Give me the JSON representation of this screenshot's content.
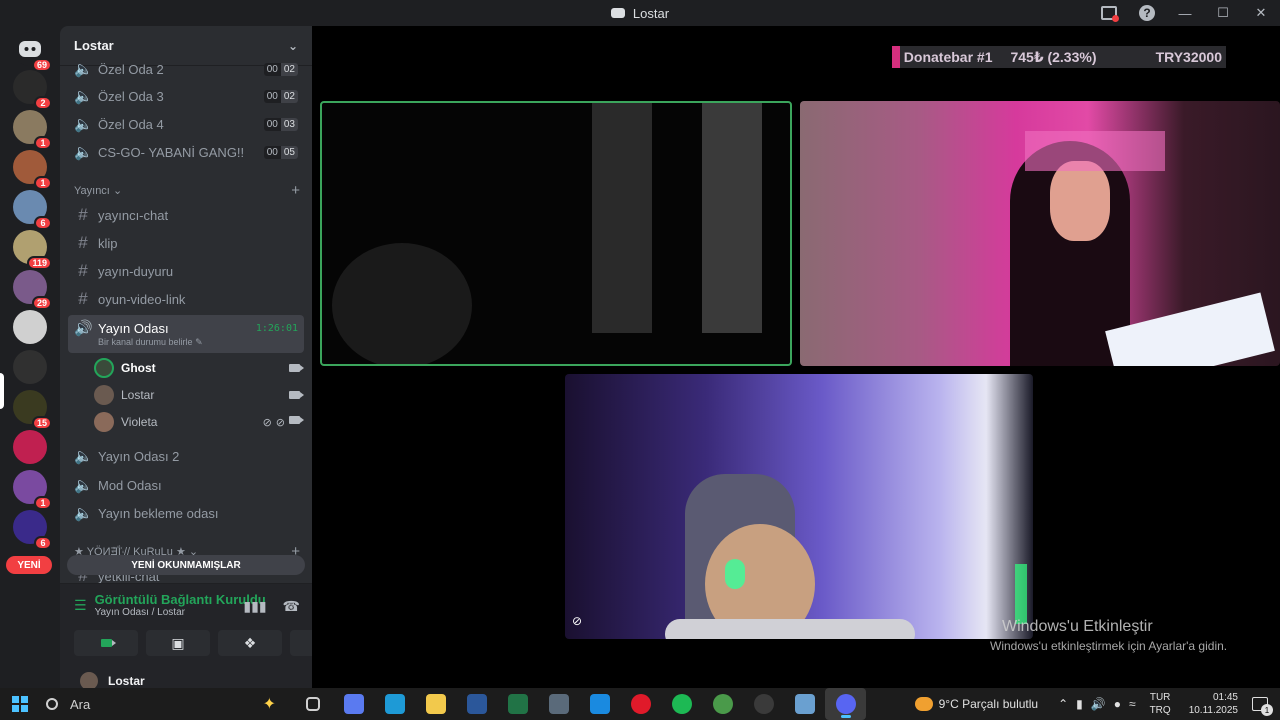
{
  "window": {
    "title": "Lostar"
  },
  "rail": {
    "home_badge": "69",
    "servers": [
      {
        "badge": "2",
        "color": "#2a2a2a"
      },
      {
        "badge": "1",
        "color": "#8a7a60"
      },
      {
        "badge": "1",
        "color": "#a05a3a"
      },
      {
        "badge": "6",
        "color": "#6a8ab0"
      },
      {
        "badge": "119",
        "color": "#b0a070"
      },
      {
        "badge": "29",
        "color": "#7a5a8a"
      },
      {
        "badge": "",
        "color": "#d0d0d0"
      },
      {
        "badge": "",
        "color": "#303030"
      },
      {
        "badge": "15",
        "color": "#3a3a20"
      },
      {
        "badge": "",
        "color": "#c02050"
      },
      {
        "badge": "1",
        "color": "#7a4aa0"
      },
      {
        "badge": "6",
        "color": "#3a2a8a"
      }
    ],
    "yeni_label": "YENİ"
  },
  "sidebar": {
    "guild_name": "Lostar",
    "top_voice": [
      {
        "name": "Özel Oda 2",
        "a": "00",
        "b": "02"
      },
      {
        "name": "Özel Oda 3",
        "a": "00",
        "b": "02"
      },
      {
        "name": "Özel Oda 4",
        "a": "00",
        "b": "03"
      },
      {
        "name": "CS-GO- YABANİ GANG!!",
        "a": "00",
        "b": "05"
      }
    ],
    "category_yayinci": "Yayıncı",
    "text_channels": [
      "yayıncı-chat",
      "klip",
      "yayın-duyuru",
      "oyun-video-link"
    ],
    "active_channel": {
      "name": "Yayın Odası",
      "time": "1:26:01",
      "status": "Bir kanal durumu belirle"
    },
    "voice_users": [
      "Ghost",
      "Lostar",
      "Violeta"
    ],
    "more_voice": [
      "Yayın Odası 2",
      "Mod Odası",
      "Yayın bekleme odası"
    ],
    "category_yonetim": "★ YÖИƎ꙰İ // KuRuLu ★",
    "partial_channel": "yetkili-chat",
    "unread_label": "YENİ OKUNMAMIŞLAR",
    "voice_panel": {
      "status": "Görüntülü Bağlantı Kuruldu",
      "location": "Yayın Odası / Lostar"
    },
    "user": {
      "name": "Lostar"
    }
  },
  "stage": {
    "donate": {
      "label": "Donatebar #1",
      "amount": "745₺ (2.33%)",
      "goal": "TRY32000",
      "progress_percent": 2.33
    },
    "watermark_title": "Windows'u Etkinleştir",
    "watermark_sub": "Windows'u etkinleştirmek için Ayarlar'a gidin."
  },
  "taskbar": {
    "search_placeholder": "Ara",
    "weather": "9°C  Parçalı bulutlu",
    "lang_top": "TUR",
    "lang_bottom": "TRQ",
    "time": "01:45",
    "date": "10.11.2025",
    "notif_count": "1",
    "apps": [
      {
        "name": "task-view",
        "color": "#2a2a2a"
      },
      {
        "name": "copilot",
        "color": "#5a7af0"
      },
      {
        "name": "edge",
        "color": "#1e9ad6"
      },
      {
        "name": "file-explorer",
        "color": "#f2c94c"
      },
      {
        "name": "word",
        "color": "#2b579a"
      },
      {
        "name": "excel",
        "color": "#217346"
      },
      {
        "name": "calculator",
        "color": "#5a6a7a"
      },
      {
        "name": "store",
        "color": "#1a8ae0"
      },
      {
        "name": "opera",
        "color": "#e01a2a"
      },
      {
        "name": "spotify",
        "color": "#1db954"
      },
      {
        "name": "chrome",
        "color": "#4a9a4a"
      },
      {
        "name": "app-clock",
        "color": "#3a3a3a"
      },
      {
        "name": "app-diamond",
        "color": "#6aa0d0"
      },
      {
        "name": "discord",
        "color": "#5865f2"
      }
    ]
  }
}
